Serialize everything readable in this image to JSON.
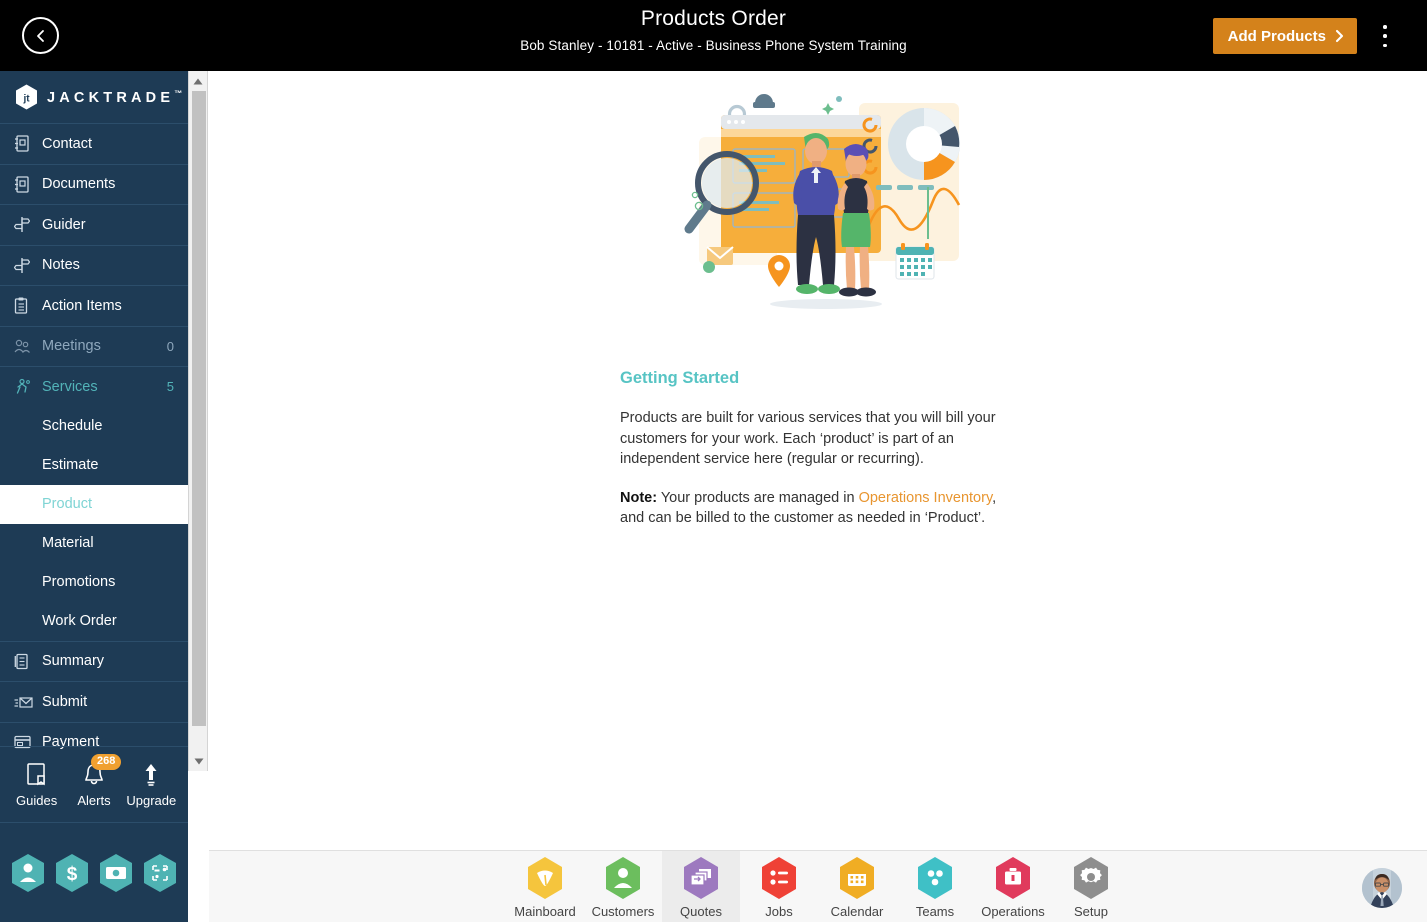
{
  "topbar": {
    "back_icon": "chevron-left-circle-icon",
    "title": "Products Order",
    "subtitle": "Bob Stanley - 10181 - Active - Business Phone System Training",
    "add_button": "Add Products",
    "add_button_icon": "chevron-right-icon",
    "menu_icon": "kebab-menu-icon",
    "bg_color": "#000000",
    "add_button_color": "#d4821b"
  },
  "sidebar": {
    "brand": "JACKTRADE",
    "brand_tm": "™",
    "bg_color": "#1e3b55",
    "items": [
      {
        "label": "Contact",
        "icon": "contact-book-icon",
        "count": "",
        "state": "normal"
      },
      {
        "label": "Documents",
        "icon": "documents-icon",
        "count": "",
        "state": "normal"
      },
      {
        "label": "Guider",
        "icon": "signpost-icon",
        "count": "",
        "state": "normal"
      },
      {
        "label": "Notes",
        "icon": "signpost-icon",
        "count": "",
        "state": "normal"
      },
      {
        "label": "Action Items",
        "icon": "clipboard-icon",
        "count": "",
        "state": "normal"
      },
      {
        "label": "Meetings",
        "icon": "meetings-icon",
        "count": "0",
        "state": "dim"
      },
      {
        "label": "Services",
        "icon": "services-icon",
        "count": "5",
        "state": "teal"
      }
    ],
    "subitems": [
      {
        "label": "Schedule",
        "active": false
      },
      {
        "label": "Estimate",
        "active": false
      },
      {
        "label": "Product",
        "active": true
      },
      {
        "label": "Material",
        "active": false
      },
      {
        "label": "Promotions",
        "active": false
      },
      {
        "label": "Work Order",
        "active": false
      }
    ],
    "tail_items": [
      {
        "label": "Summary",
        "icon": "summary-icon",
        "count": "",
        "state": "normal"
      },
      {
        "label": "Submit",
        "icon": "submit-mail-icon",
        "count": "",
        "state": "normal"
      },
      {
        "label": "Payment",
        "icon": "payment-card-icon",
        "count": "",
        "state": "normal"
      }
    ],
    "quick_actions": [
      {
        "label": "Guides",
        "icon": "book-icon",
        "badge": ""
      },
      {
        "label": "Alerts",
        "icon": "bell-icon",
        "badge": "268"
      },
      {
        "label": "Upgrade",
        "icon": "upload-arrow-icon",
        "badge": ""
      }
    ],
    "hex_shortcuts": [
      {
        "name": "person-hex-icon"
      },
      {
        "name": "dollar-hex-icon"
      },
      {
        "name": "money-hex-icon"
      },
      {
        "name": "workflow-hex-icon"
      }
    ],
    "badge_color": "#f0a030",
    "accent_teal": "#52b3b8"
  },
  "scrollbar": {
    "up_icon": "scroll-up-arrow-icon",
    "down_icon": "scroll-down-arrow-icon"
  },
  "main": {
    "hero_illustration": "people-dashboard-analytics-illustration",
    "heading": "Getting Started",
    "paragraph1": "Products are built for various services that you will bill your customers for your work. Each ‘product’ is part of an independent service here (regular or recurring).",
    "note_label": "Note:",
    "note_before": " Your products are managed in ",
    "note_link": "Operations Inventory",
    "note_after": ", and can be billed to the customer as needed in ‘Product’.",
    "heading_color": "#57c4c4",
    "link_color": "#e8952f"
  },
  "bottombar": {
    "tabs": [
      {
        "label": "Mainboard",
        "icon": "mainboard-hex-icon",
        "color": "#f5c53d",
        "active": false
      },
      {
        "label": "Customers",
        "icon": "customers-hex-icon",
        "color": "#6cbe5e",
        "active": false
      },
      {
        "label": "Quotes",
        "icon": "quotes-hex-icon",
        "color": "#9d79bf",
        "active": true
      },
      {
        "label": "Jobs",
        "icon": "jobs-hex-icon",
        "color": "#ef4136",
        "active": false
      },
      {
        "label": "Calendar",
        "icon": "calendar-hex-icon",
        "color": "#f0ad24",
        "active": false
      },
      {
        "label": "Teams",
        "icon": "teams-hex-icon",
        "color": "#3fc0c6",
        "active": false
      },
      {
        "label": "Operations",
        "icon": "operations-hex-icon",
        "color": "#e03a5c",
        "active": false
      },
      {
        "label": "Setup",
        "icon": "setup-hex-icon",
        "color": "#8e8e8e",
        "active": false
      }
    ],
    "avatar": "user-profile-avatar",
    "bg_color": "#f7f7f7"
  }
}
